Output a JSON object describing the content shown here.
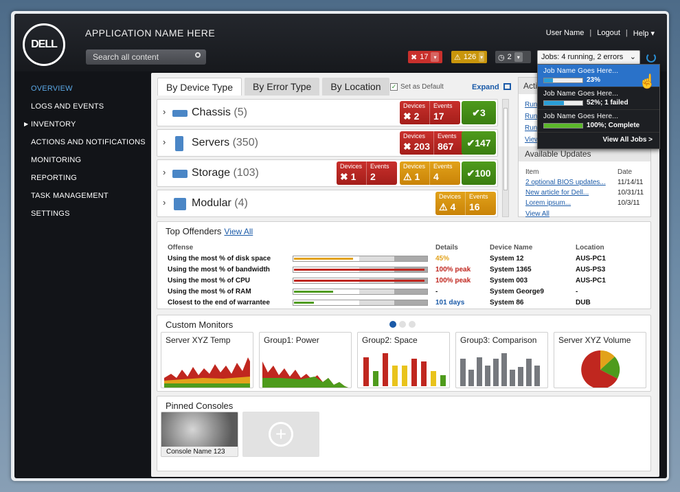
{
  "header": {
    "logo": "DELL",
    "app_name": "APPLICATION NAME HERE",
    "search_placeholder": "Search all content",
    "user_nav": [
      "User Name",
      "Logout",
      "Help"
    ],
    "stats": {
      "errors": "17",
      "warnings": "126",
      "jobs_count": "2"
    },
    "jobs_select": "Jobs:  4 running, 2 errors"
  },
  "sidebar": {
    "items": [
      "OVERVIEW",
      "LOGS AND EVENTS",
      "INVENTORY",
      "ACTIONS AND NOTIFICATIONS",
      "MONITORING",
      "REPORTING",
      "TASK MANAGEMENT",
      "SETTINGS"
    ]
  },
  "tabs": [
    "By Device Type",
    "By Error Type",
    "By Location"
  ],
  "set_as_default": "Set as Default",
  "expand": "Expand",
  "device_rows": [
    {
      "name": "Chassis",
      "count": "(5)"
    },
    {
      "name": "Servers",
      "count": "(350)"
    },
    {
      "name": "Storage",
      "count": "(103)"
    },
    {
      "name": "Modular",
      "count": "(4)"
    }
  ],
  "badge_labels": {
    "devices": "Devices",
    "events": "Events"
  },
  "badges": {
    "chassis_red": [
      "2",
      "17"
    ],
    "chassis_ok": "3",
    "servers_red": [
      "203",
      "867"
    ],
    "servers_ok": "147",
    "storage_red": [
      "1",
      "2"
    ],
    "storage_amb": [
      "1",
      "4"
    ],
    "storage_ok": "100",
    "modular_amb": [
      "4",
      "16"
    ]
  },
  "actions_panel": {
    "title": "Acti",
    "links": [
      "Run",
      "Run",
      "Run",
      "View"
    ]
  },
  "available_updates": {
    "title": "Available Updates",
    "col_item": "Item",
    "col_date": "Date",
    "items": [
      {
        "item": "2 optional BIOS updates...",
        "date": "11/14/11"
      },
      {
        "item": "New article for Dell...",
        "date": "10/31/11"
      },
      {
        "item": "Lorem ipsum...",
        "date": "10/3/11"
      }
    ],
    "view_all": "View All"
  },
  "top_offenders": {
    "title": "Top Offenders",
    "view_all": "View All",
    "headers": [
      "Offense",
      "Details",
      "Device Name",
      "Location"
    ],
    "rows": [
      {
        "offense": "Using the most % of disk space",
        "level": 0.45,
        "details": "45%",
        "device": "System 12",
        "location": "AUS-PC1"
      },
      {
        "offense": "Using the most % of bandwidth",
        "level": 1.0,
        "details": "100% peak",
        "device": "System 1365",
        "location": "AUS-PS3"
      },
      {
        "offense": "Using the most % of CPU",
        "level": 1.0,
        "details": "100% peak",
        "device": "System 003",
        "location": "AUS-PC1"
      },
      {
        "offense": "Using the most % of RAM",
        "level": 0.3,
        "details": "-",
        "device": "System George9",
        "location": "-"
      },
      {
        "offense": "Closest to the end of warrantee",
        "level": 0.15,
        "details": "101 days",
        "device": "System 86",
        "location": "DUB"
      }
    ],
    "colors": {
      "amber": "#e2a21a",
      "red": "#c0271f",
      "green": "#4e9b1c",
      "blue": "#1a5aa8"
    }
  },
  "custom_monitors": {
    "title": "Custom Monitors",
    "monitors": [
      "Server XYZ Temp",
      "Group1: Power",
      "Group2: Space",
      "Group3: Comparison",
      "Server XYZ Volume"
    ]
  },
  "pinned_consoles": {
    "title": "Pinned Consoles",
    "console_name": "Console Name 123"
  },
  "jobs_dropdown": {
    "jobs": [
      {
        "name": "Job Name Goes Here...",
        "progress": 0.23,
        "text": "23%"
      },
      {
        "name": "Job Name Goes Here...",
        "progress": 0.52,
        "text": "52%; 1 failed"
      },
      {
        "name": "Job Name Goes Here...",
        "progress": 1.0,
        "text": "100%; Complete"
      }
    ],
    "view_all": "View All Jobs >"
  }
}
